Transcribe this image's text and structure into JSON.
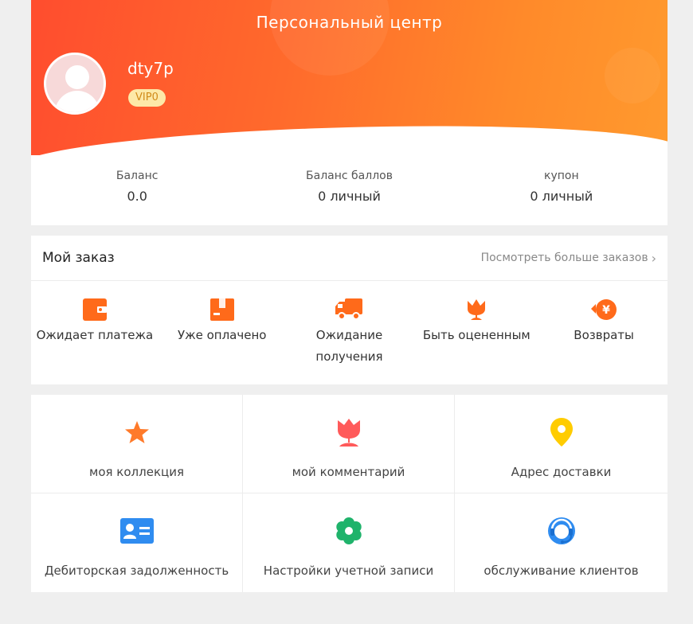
{
  "header": {
    "title": "Персональный центр",
    "username": "dty7p",
    "vip_badge": "VIP0"
  },
  "stats": [
    {
      "label": "Баланс",
      "value": "0.0"
    },
    {
      "label": "Баланс баллов",
      "value": "0 личный"
    },
    {
      "label": "купон",
      "value": "0 личный"
    }
  ],
  "orders": {
    "title": "Мой заказ",
    "more_label": "Посмотреть больше заказов",
    "items": [
      {
        "label": "Ожидает платежа",
        "icon": "wallet-icon"
      },
      {
        "label": "Уже оплачено",
        "icon": "package-icon"
      },
      {
        "label": "Ожидание получения",
        "icon": "truck-icon"
      },
      {
        "label": "Быть оцененным",
        "icon": "flower-icon"
      },
      {
        "label": "Возвраты",
        "icon": "refund-icon"
      }
    ]
  },
  "menu": [
    {
      "label": "моя коллекция",
      "icon": "star-icon"
    },
    {
      "label": "мой комментарий",
      "icon": "tulip-icon"
    },
    {
      "label": "Адрес доставки",
      "icon": "location-pin-icon"
    },
    {
      "label": "Дебиторская задолженность",
      "icon": "id-card-icon"
    },
    {
      "label": "Настройки учетной записи",
      "icon": "settings-gear-icon"
    },
    {
      "label": "обслуживание клиентов",
      "icon": "headset-icon"
    }
  ],
  "colors": {
    "header_start": "#ff4d2e",
    "header_end": "#ff9a2e",
    "order_icon": "#ff6a1a",
    "star": "#ff7a2a",
    "tulip": "#ff5a5a",
    "pin": "#ffcc00",
    "card": "#2f8cf0",
    "gear": "#1fb36b",
    "headset": "#2f8cf0"
  }
}
